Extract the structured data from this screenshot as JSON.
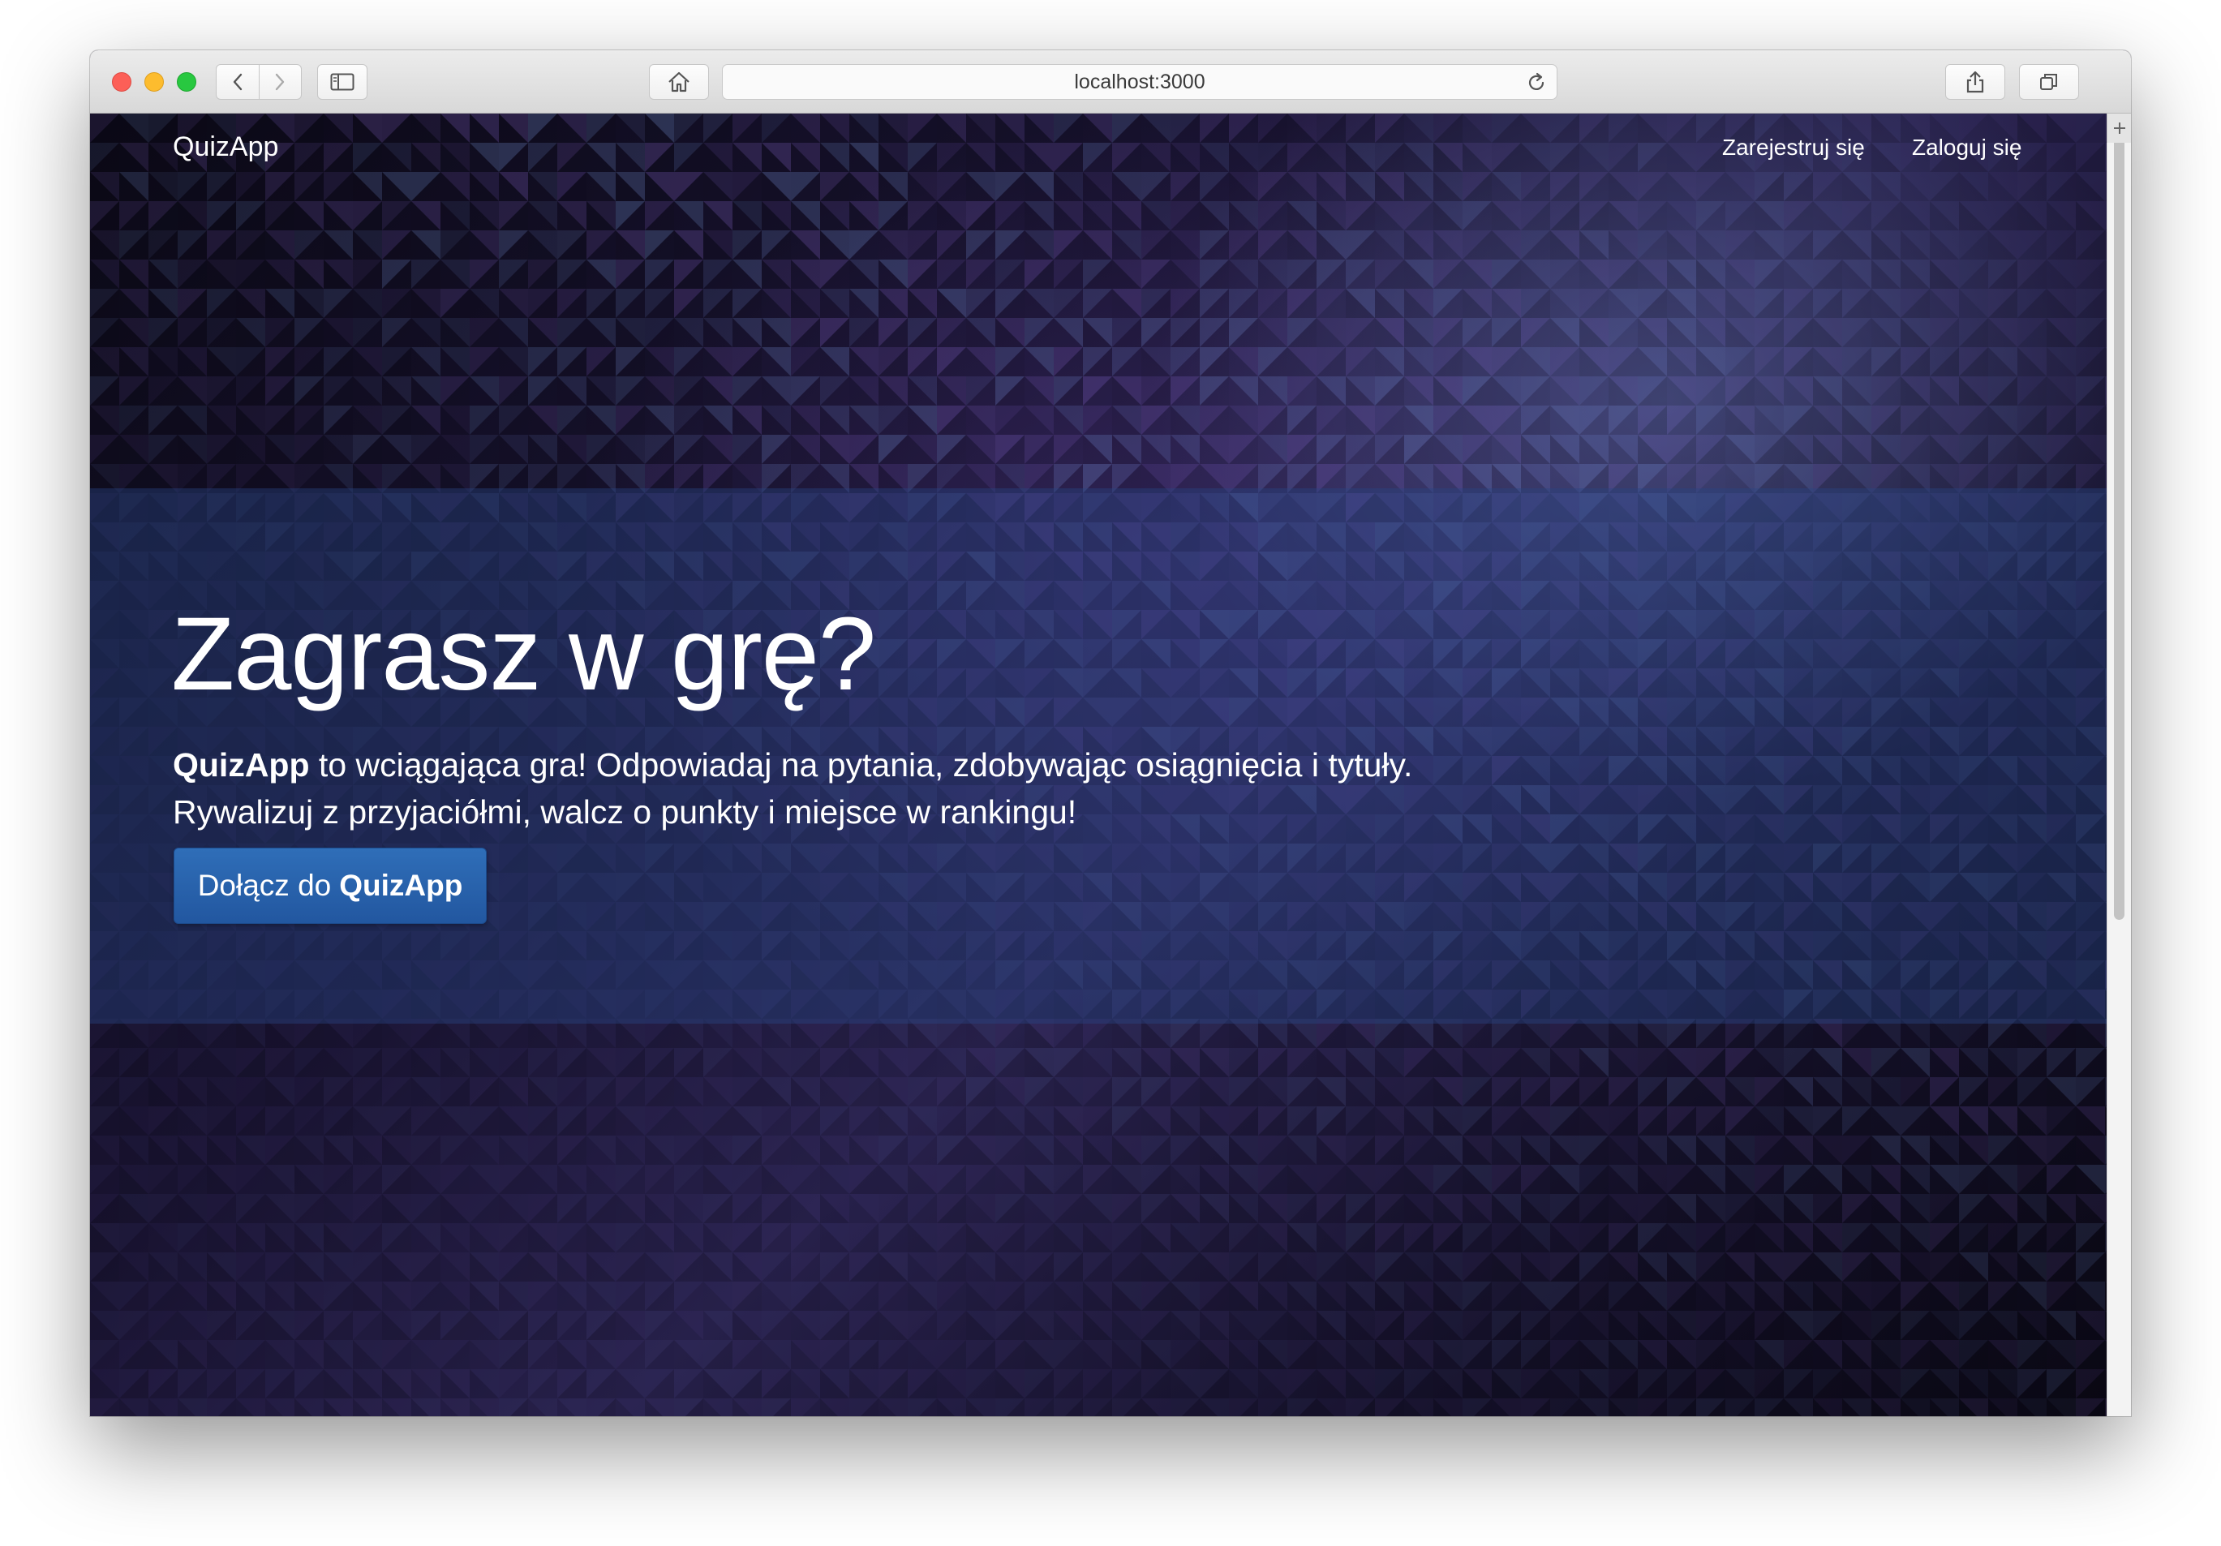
{
  "browser": {
    "url": "localhost:3000"
  },
  "navbar": {
    "brand": "QuizApp",
    "links": [
      {
        "label": "Zarejestruj się"
      },
      {
        "label": "Zaloguj się"
      }
    ]
  },
  "hero": {
    "title": "Zagrasz w grę?",
    "line1_brand": "QuizApp",
    "line1_rest": " to wciągająca gra! Odpowiadaj na pytania, zdobywając osiągnięcia i tytuły.",
    "line2": "Rywalizuj z przyjaciółmi, walcz o punkty i miejsce w rankingu!",
    "cta_prefix": "Dołącz do",
    "cta_brand": "QuizApp"
  },
  "colors": {
    "cta_blue": "#2a64ae",
    "text": "#ffffff",
    "background_dark": "#0c0a18",
    "background_purple": "#2a2350"
  },
  "icons": [
    "back-chevron-icon",
    "forward-chevron-icon",
    "sidebar-icon",
    "home-icon",
    "reload-icon",
    "share-icon",
    "tabs-icon",
    "new-tab-plus-icon"
  ]
}
